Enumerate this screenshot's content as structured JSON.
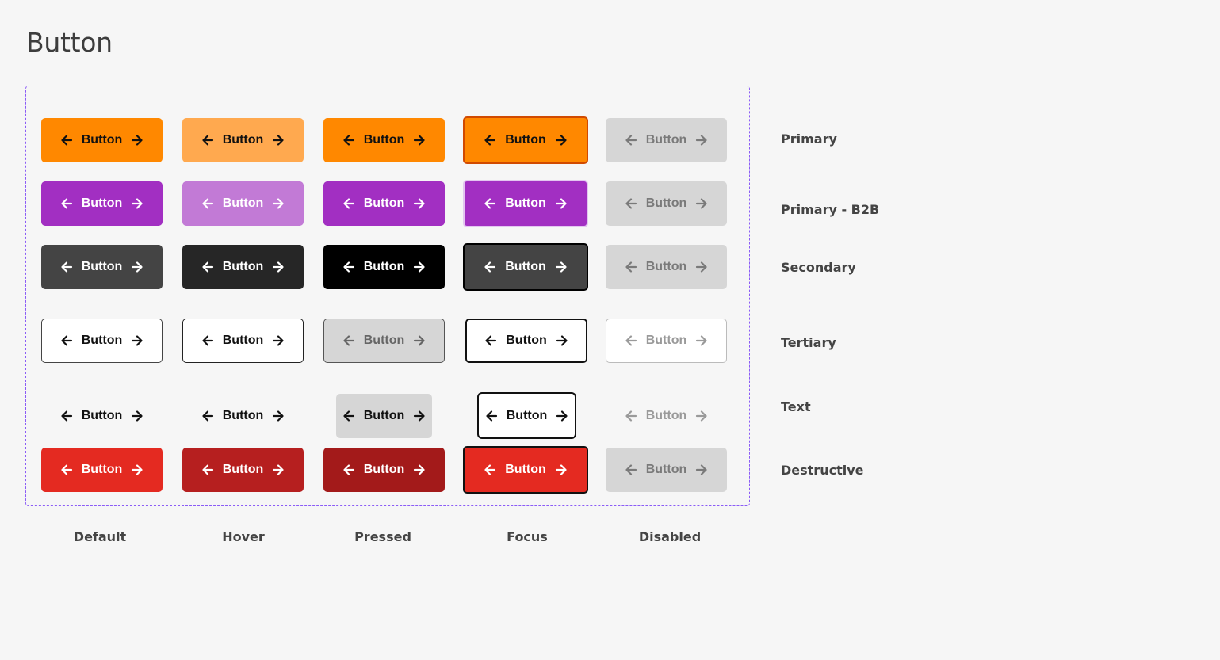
{
  "page": {
    "title": "Button"
  },
  "button_label": "Button",
  "icons": {
    "leading": "arrow-left-icon",
    "trailing": "arrow-right-icon"
  },
  "colors": {
    "background": "#f6f6f6",
    "frame_border": "#8b5cf6",
    "primary": "#ff8800",
    "primary_b2b": "#a22fc2",
    "secondary": "#444444",
    "destructive": "#e42a21",
    "disabled_fill": "#d6d6d6"
  },
  "rows": [
    {
      "key": "primary",
      "label": "Primary"
    },
    {
      "key": "primary-b2b",
      "label": "Primary - B2B"
    },
    {
      "key": "secondary",
      "label": "Secondary"
    },
    {
      "key": "tertiary",
      "label": "Tertiary"
    },
    {
      "key": "text",
      "label": "Text"
    },
    {
      "key": "destructive",
      "label": "Destructive"
    }
  ],
  "columns": [
    {
      "key": "default",
      "label": "Default"
    },
    {
      "key": "hover",
      "label": "Hover"
    },
    {
      "key": "pressed",
      "label": "Pressed"
    },
    {
      "key": "focus",
      "label": "Focus"
    },
    {
      "key": "disabled",
      "label": "Disabled"
    }
  ]
}
